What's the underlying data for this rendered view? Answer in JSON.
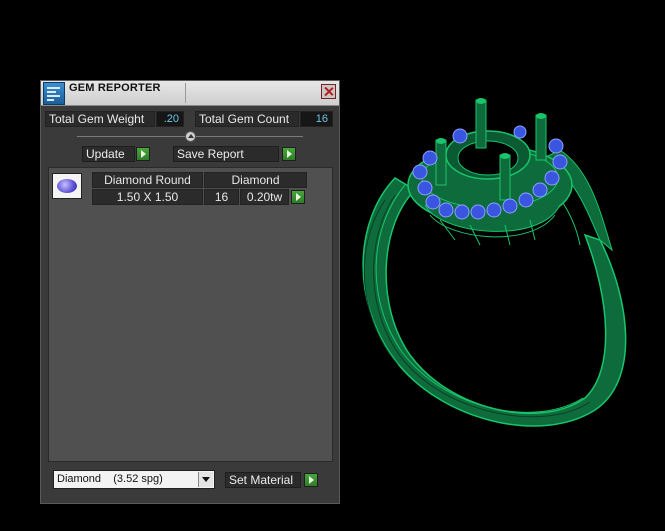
{
  "panel": {
    "title": "GEM REPORTER",
    "total_gem_weight_label": "Total Gem Weight",
    "total_gem_weight_value": ".20",
    "total_gem_count_label": "Total Gem Count",
    "total_gem_count_value": "16",
    "update_label": "Update",
    "save_report_label": "Save Report",
    "gem_row": {
      "shape_header": "Diamond Round",
      "material_header": "Diamond",
      "size": "1.50 X 1.50",
      "count": "16",
      "weight": "0.20tw"
    },
    "material_select": "Diamond    (3.52 spg)",
    "set_material_label": "Set Material"
  },
  "colors": {
    "ring_metal": "#0e6b3c",
    "ring_wire": "#19c46a",
    "gem_accent": "#3a56e0",
    "value_text": "#6cc9e6",
    "arrow_button": "#3f9a33"
  }
}
